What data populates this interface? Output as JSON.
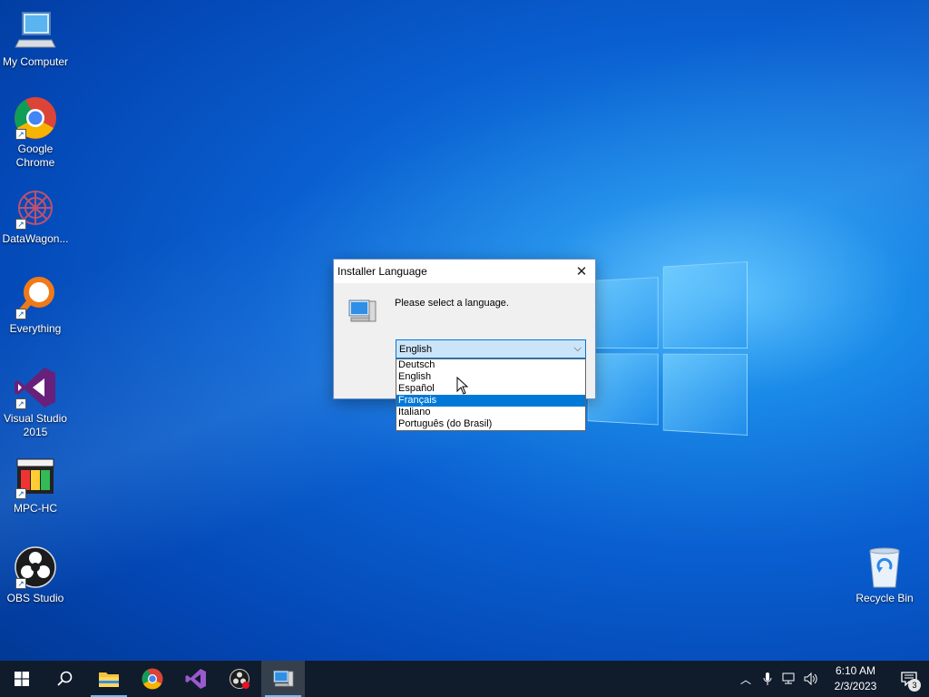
{
  "desktop": {
    "icons": [
      {
        "label": "My Computer",
        "icon": "computer-icon"
      },
      {
        "label": "Google Chrome",
        "icon": "chrome-icon"
      },
      {
        "label": "DataWagon...",
        "icon": "datawagon-icon"
      },
      {
        "label": "Everything",
        "icon": "everything-search-icon"
      },
      {
        "label": "Visual Studio 2015",
        "icon": "visual-studio-icon"
      },
      {
        "label": "MPC-HC",
        "icon": "mpc-hc-icon"
      },
      {
        "label": "OBS Studio",
        "icon": "obs-icon"
      },
      {
        "label": "Recycle Bin",
        "icon": "recycle-bin-icon"
      }
    ]
  },
  "dialog": {
    "title": "Installer Language",
    "prompt": "Please select a language.",
    "combo_value": "English",
    "options": [
      "Deutsch",
      "English",
      "Español",
      "Français",
      "Italiano",
      "Português (do Brasil)"
    ],
    "highlighted_option": "Français"
  },
  "taskbar": {
    "apps": [
      "start-icon",
      "search-icon",
      "file-explorer-icon",
      "chrome-icon",
      "visual-studio-icon",
      "obs-icon",
      "installer-icon"
    ],
    "time": "6:10 AM",
    "date": "2/3/2023",
    "notification_count": "3"
  },
  "colors": {
    "accent": "#0078d7",
    "taskbar": "#101c2c"
  }
}
